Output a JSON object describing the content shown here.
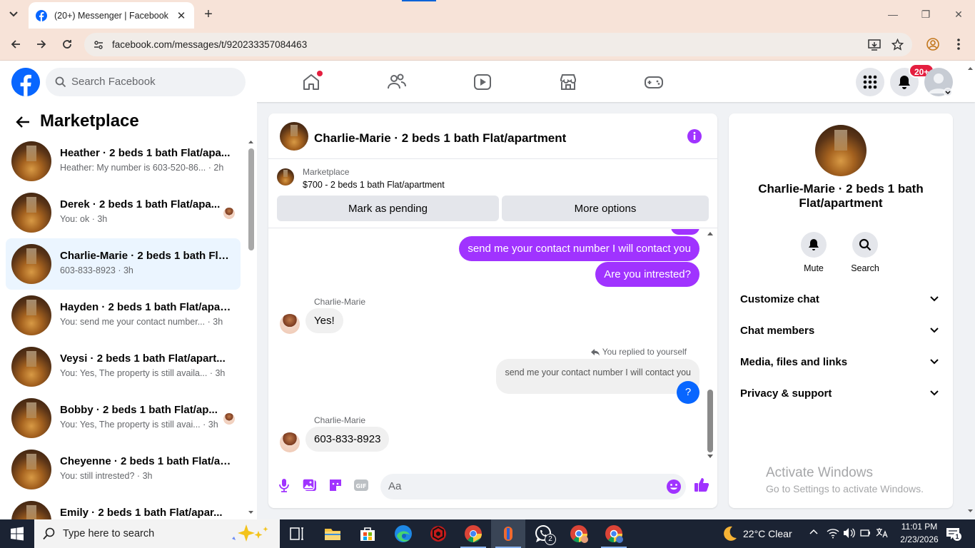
{
  "browser": {
    "tab_title": "(20+) Messenger | Facebook",
    "url": "facebook.com/messages/t/920233357084463"
  },
  "fb": {
    "search_placeholder": "Search Facebook",
    "notifications_badge": "20+"
  },
  "left": {
    "title": "Marketplace",
    "conversations": [
      {
        "name": "Heather · 2 beds 1 bath Flat/apa...",
        "preview": "Heather: My number is 603-520-86... · 2h"
      },
      {
        "name": "Derek · 2 beds 1 bath Flat/apa...",
        "preview": "You: ok · 3h"
      },
      {
        "name": "Charlie-Marie · 2 beds 1 bath Fla...",
        "preview": "603-833-8923 · 3h"
      },
      {
        "name": "Hayden · 2 beds 1 bath Flat/apar...",
        "preview": "You: send me your contact number... · 3h"
      },
      {
        "name": "Veysi · 2 beds 1 bath Flat/apart...",
        "preview": "You: Yes, The property is still availa... · 3h"
      },
      {
        "name": "Bobby · 2 beds 1 bath Flat/ap...",
        "preview": "You: Yes, The property is still avai... · 3h"
      },
      {
        "name": "Cheyenne · 2 beds 1 bath Flat/ap...",
        "preview": "You: still intrested? · 3h"
      },
      {
        "name": "Emily · 2 beds 1 bath Flat/apar...",
        "preview": ""
      }
    ]
  },
  "chat": {
    "title": "Charlie-Marie · 2 beds 1 bath Flat/apartment",
    "marketplace_label": "Marketplace",
    "listing": "$700 - 2 beds 1 bath Flat/apartment",
    "mark_pending": "Mark as pending",
    "more_options": "More options",
    "messages": {
      "out1": "send me your contact number I will contact you",
      "out2": "Are you intrested?",
      "sender1": "Charlie-Marie",
      "in1": "Yes!",
      "replied": "You replied to yourself",
      "quoted": "send me your contact number I will contact you",
      "out3": "?",
      "sender2": "Charlie-Marie",
      "in2": "603-833-8923"
    },
    "composer_placeholder": "Aa"
  },
  "right": {
    "name": "Charlie-Marie · 2 beds 1 bath Flat/apartment",
    "mute": "Mute",
    "search": "Search",
    "sections": [
      "Customize chat",
      "Chat members",
      "Media, files and links",
      "Privacy & support"
    ]
  },
  "watermark": {
    "line1": "Activate Windows",
    "line2": "Go to Settings to activate Windows."
  },
  "taskbar": {
    "search_placeholder": "Type here to search",
    "weather": "22°C  Clear",
    "time": "11:01 PM",
    "date": "2/23/2026",
    "whatsapp_badge": "2",
    "notif_count": "1"
  },
  "colors": {
    "accent": "#a033ff",
    "fb_blue": "#0866ff",
    "badge_red": "#e41e3f"
  }
}
